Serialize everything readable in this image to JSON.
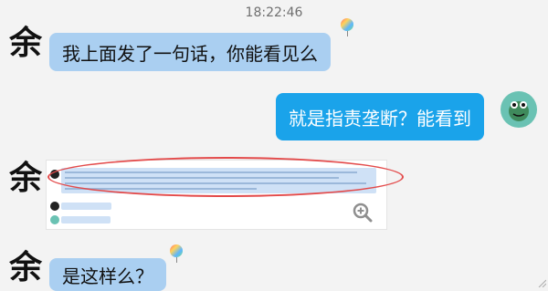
{
  "timestamp": "18:22:46",
  "messages": [
    {
      "side": "left",
      "avatar_char": "余",
      "text": "我上面发了一句话，你能看见么"
    },
    {
      "side": "right",
      "avatar_icon": "frog-avatar-icon",
      "text": "就是指责垄断？能看到"
    },
    {
      "side": "left",
      "avatar_char": "余",
      "type": "screenshot",
      "caption": "",
      "icons": [
        "zoom-in-icon"
      ]
    },
    {
      "side": "left",
      "avatar_char": "余",
      "text": "是这样么？"
    }
  ],
  "colors": {
    "bg": "#f3f3f3",
    "bubble_left": "#aacff1",
    "bubble_right": "#1aa3ea",
    "highlight": "#e34a4a"
  }
}
